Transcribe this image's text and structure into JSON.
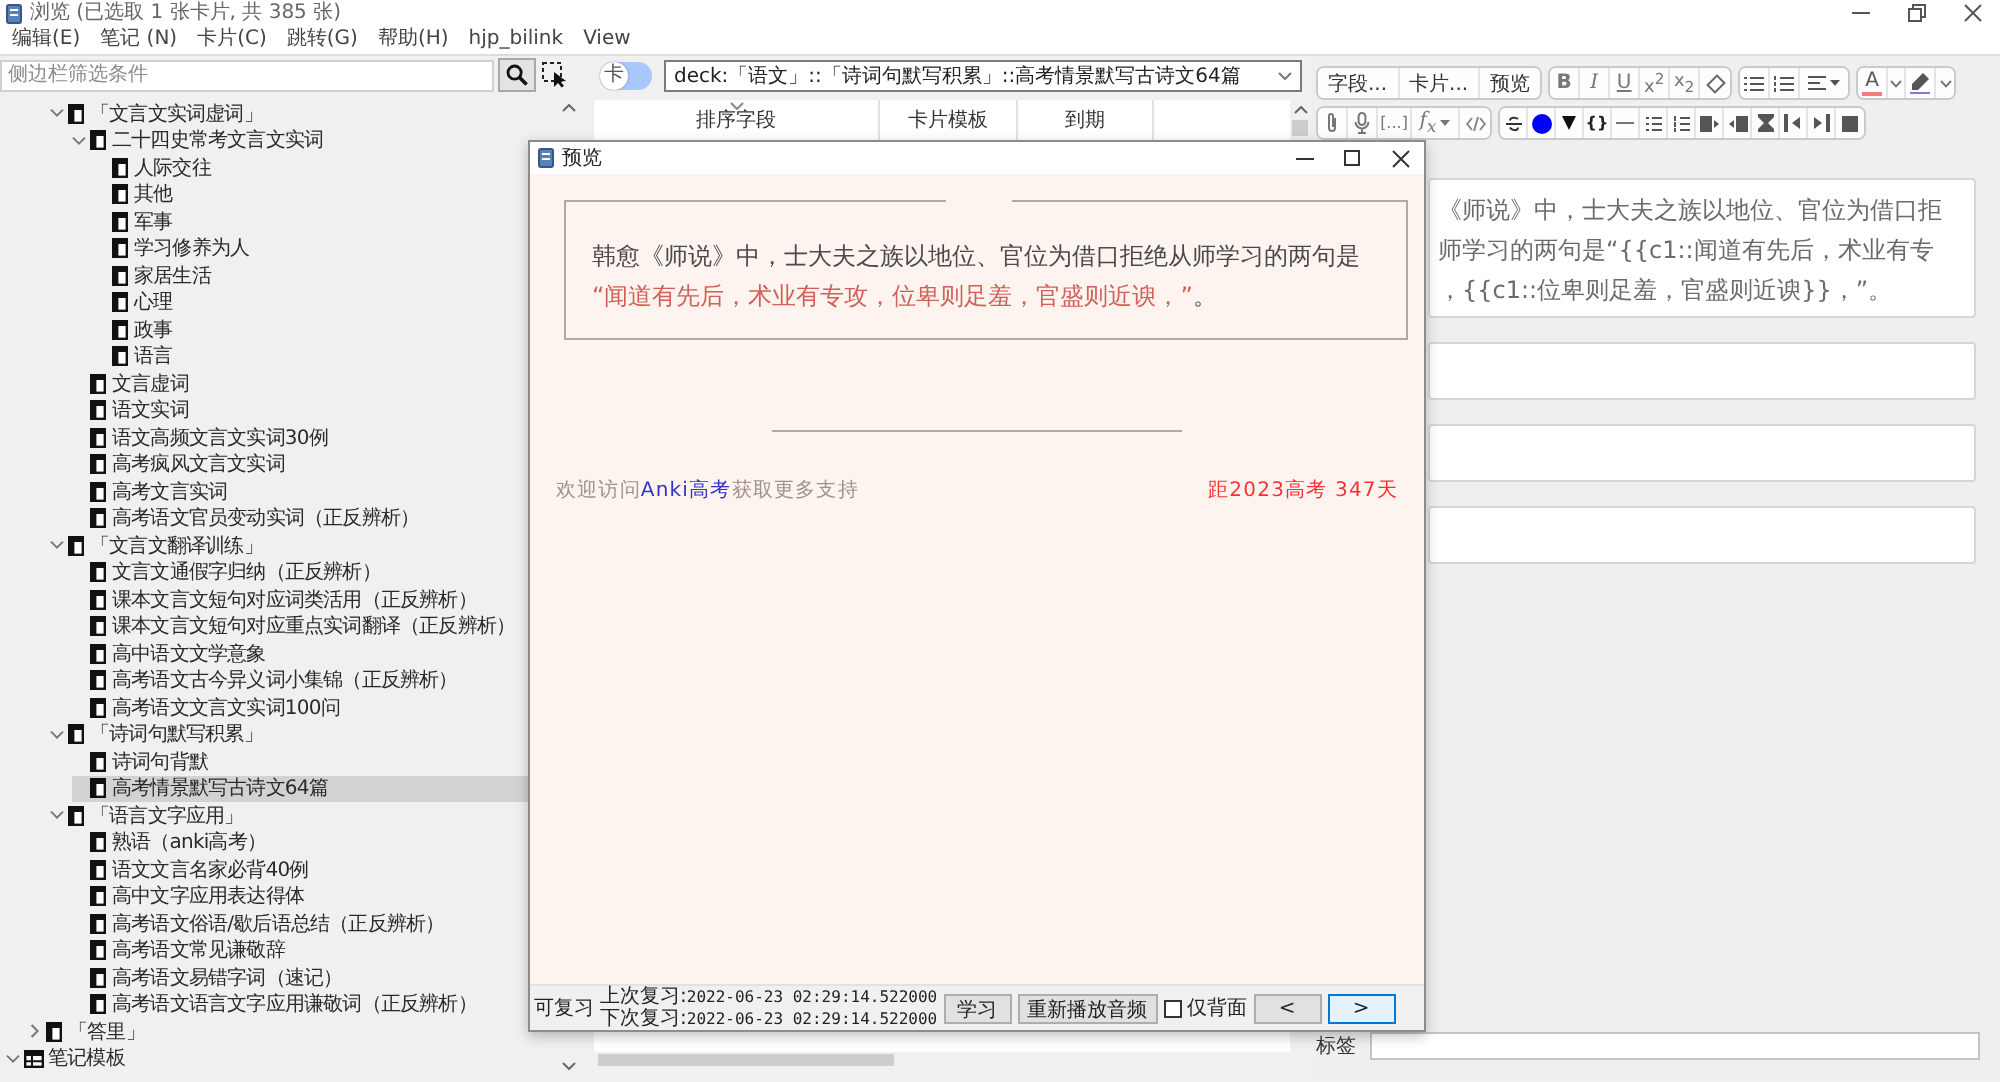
{
  "window": {
    "title": "浏览 (已选取 1 张卡片, 共 385 张)"
  },
  "menu": [
    "编辑(E)",
    "笔记 (N)",
    "卡片(C)",
    "跳转(G)",
    "帮助(H)",
    "hjp_bilink",
    "View"
  ],
  "sidebar": {
    "search": {
      "placeholder": "侧边栏筛选条件"
    },
    "tree": [
      {
        "children": [
          {
            "children": [
              {
                "label": "「文言文实词虚词」",
                "kind": "deck",
                "expanded": true,
                "selected": false,
                "children": [
                  {
                    "label": "二十四史常考文言文实词",
                    "kind": "deck",
                    "expanded": true,
                    "selected": false,
                    "children": [
                      {
                        "label": "人际交往",
                        "kind": "deck",
                        "selected": false
                      },
                      {
                        "label": "其他",
                        "kind": "deck",
                        "selected": false
                      },
                      {
                        "label": "军事",
                        "kind": "deck",
                        "selected": false
                      },
                      {
                        "label": "学习修养为人",
                        "kind": "deck",
                        "selected": false
                      },
                      {
                        "label": "家居生活",
                        "kind": "deck",
                        "selected": false
                      },
                      {
                        "label": "心理",
                        "kind": "deck",
                        "selected": false
                      },
                      {
                        "label": "政事",
                        "kind": "deck",
                        "selected": false
                      },
                      {
                        "label": "语言",
                        "kind": "deck",
                        "selected": false
                      }
                    ]
                  },
                  {
                    "label": "文言虚词",
                    "kind": "deck",
                    "selected": false
                  },
                  {
                    "label": "语文实词",
                    "kind": "deck",
                    "selected": false
                  },
                  {
                    "label": "语文高频文言文实词30例",
                    "kind": "deck",
                    "selected": false
                  },
                  {
                    "label": "高考疯风文言文实词",
                    "kind": "deck",
                    "selected": false
                  },
                  {
                    "label": "高考文言实词",
                    "kind": "deck",
                    "selected": false
                  },
                  {
                    "label": "高考语文官员变动实词（正反辨析）",
                    "kind": "deck",
                    "selected": false
                  }
                ]
              },
              {
                "label": "「文言文翻译训练」",
                "kind": "deck",
                "expanded": true,
                "selected": false,
                "children": [
                  {
                    "label": "文言文通假字归纳（正反辨析）",
                    "kind": "deck",
                    "selected": false
                  },
                  {
                    "label": "课本文言文短句对应词类活用（正反辨析）",
                    "kind": "deck",
                    "selected": false
                  },
                  {
                    "label": "课本文言文短句对应重点实词翻译（正反辨析）",
                    "kind": "deck",
                    "selected": false
                  },
                  {
                    "label": "高中语文文学意象",
                    "kind": "deck",
                    "selected": false
                  },
                  {
                    "label": "高考语文古今异义词小集锦（正反辨析）",
                    "kind": "deck",
                    "selected": false
                  },
                  {
                    "label": "高考语文文言文实词100问",
                    "kind": "deck",
                    "selected": false
                  }
                ]
              },
              {
                "label": "「诗词句默写积累」",
                "kind": "deck",
                "expanded": true,
                "selected": false,
                "children": [
                  {
                    "label": "诗词句背默",
                    "kind": "deck",
                    "selected": false
                  },
                  {
                    "label": "高考情景默写古诗文64篇",
                    "kind": "deck",
                    "selected": true
                  }
                ]
              },
              {
                "label": "「语言文字应用」",
                "kind": "deck",
                "expanded": true,
                "selected": false,
                "children": [
                  {
                    "label": "熟语（anki高考）",
                    "kind": "deck",
                    "selected": false
                  },
                  {
                    "label": "语文文言名家必背40例",
                    "kind": "deck",
                    "selected": false
                  },
                  {
                    "label": "高中文字应用表达得体",
                    "kind": "deck",
                    "selected": false
                  },
                  {
                    "label": "高考语文俗语/歇后语总结（正反辨析）",
                    "kind": "deck",
                    "selected": false
                  },
                  {
                    "label": "高考语文常见谦敬辞",
                    "kind": "deck",
                    "selected": false
                  },
                  {
                    "label": "高考语文易错字词（速记）",
                    "kind": "deck",
                    "selected": false
                  },
                  {
                    "label": "高考语文语言文字应用谦敬词（正反辨析）",
                    "kind": "deck",
                    "selected": false
                  }
                ]
              }
            ]
          },
          {
            "label": "「答里」",
            "kind": "deck",
            "expanded": false,
            "selected": false
          }
        ]
      },
      {
        "label": "笔记模板",
        "kind": "notetype",
        "expanded": true,
        "selected": false
      }
    ]
  },
  "browser": {
    "mode_switch": {
      "label": "卡",
      "on": false
    },
    "search": {
      "value": "deck:「语文」::「诗词句默写积累」::高考情景默写古诗文64篇"
    },
    "columns": [
      {
        "label": "排序字段",
        "sorted": true
      },
      {
        "label": "卡片模板",
        "sorted": false
      },
      {
        "label": "到期",
        "sorted": false
      }
    ]
  },
  "editor": {
    "toolbar": {
      "fields": "字段...",
      "cards": "卡片...",
      "preview": "预览",
      "bold": "B",
      "italic": "I",
      "underline": "U",
      "superscript": "x$^{2}$",
      "subscript": "x$_{2}$",
      "text_color": "A",
      "cloze": "[...]",
      "formula": "f$_{x}$",
      "braces": "{}"
    },
    "field_lines": [
      "《师说》中，士大夫之族以地位、官位为借口拒",
      "师学习的两句是“{{c1::闻道有先后，术业有专",
      "，{{c1::位卑则足羞，官盛则近谀}}，”。"
    ],
    "tags": {
      "label": "标签"
    }
  },
  "preview": {
    "title": "预览",
    "question": {
      "text": "韩愈《师说》中，士大夫之族以地位、官位为借口拒绝从师学习的两句是",
      "answer": "“闻道有先后，术业有专攻，位卑则足羞，官盛则近谀，”",
      "end": "。"
    },
    "footer": {
      "before": "欢迎访问",
      "link": "Anki高考",
      "after": "获取更多支持",
      "countdown": "距2023高考 347天"
    },
    "status": "可复习",
    "last_review": {
      "label": "上次复习:",
      "value": "2022-06-23 02:29:14.522000"
    },
    "next_review": {
      "label": "下次复习:",
      "value": "2022-06-23 02:29:14.522000"
    },
    "study_button": "学习",
    "replay_button": "重新播放音频",
    "back_only": {
      "label": "仅背面",
      "checked": false
    },
    "nav": [
      {
        "label": "<",
        "focused": false
      },
      {
        "label": ">",
        "focused": true
      }
    ]
  }
}
